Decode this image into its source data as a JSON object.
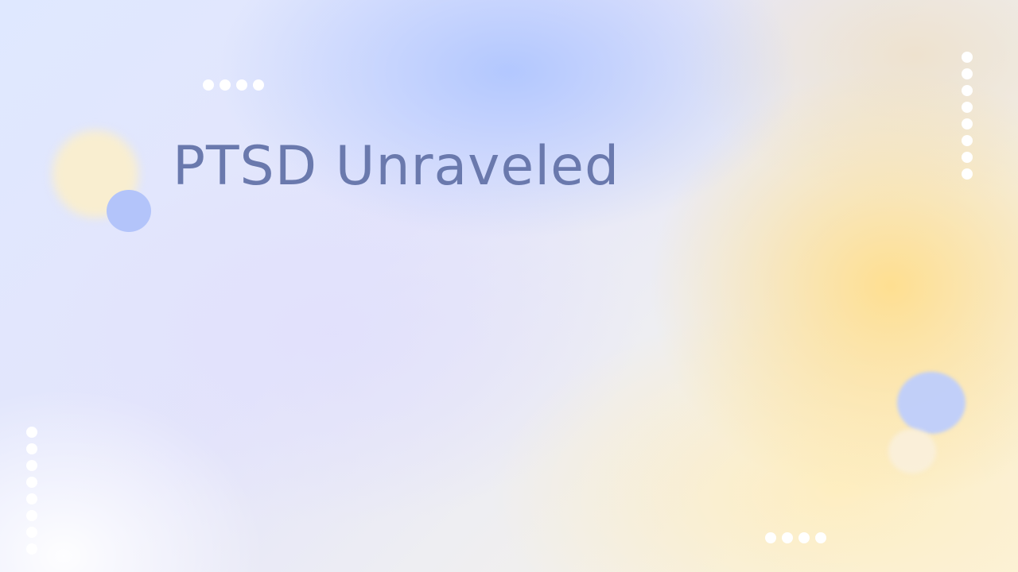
{
  "slide": {
    "title": "PTSD Unraveled"
  },
  "colors": {
    "title_text": "#6a79ad",
    "accent_blue": "#b3c4fa",
    "accent_yellow": "#ffde8c",
    "dots": "#ffffff"
  },
  "icons": {
    "decorative_dots": "dot-pattern-icon"
  }
}
